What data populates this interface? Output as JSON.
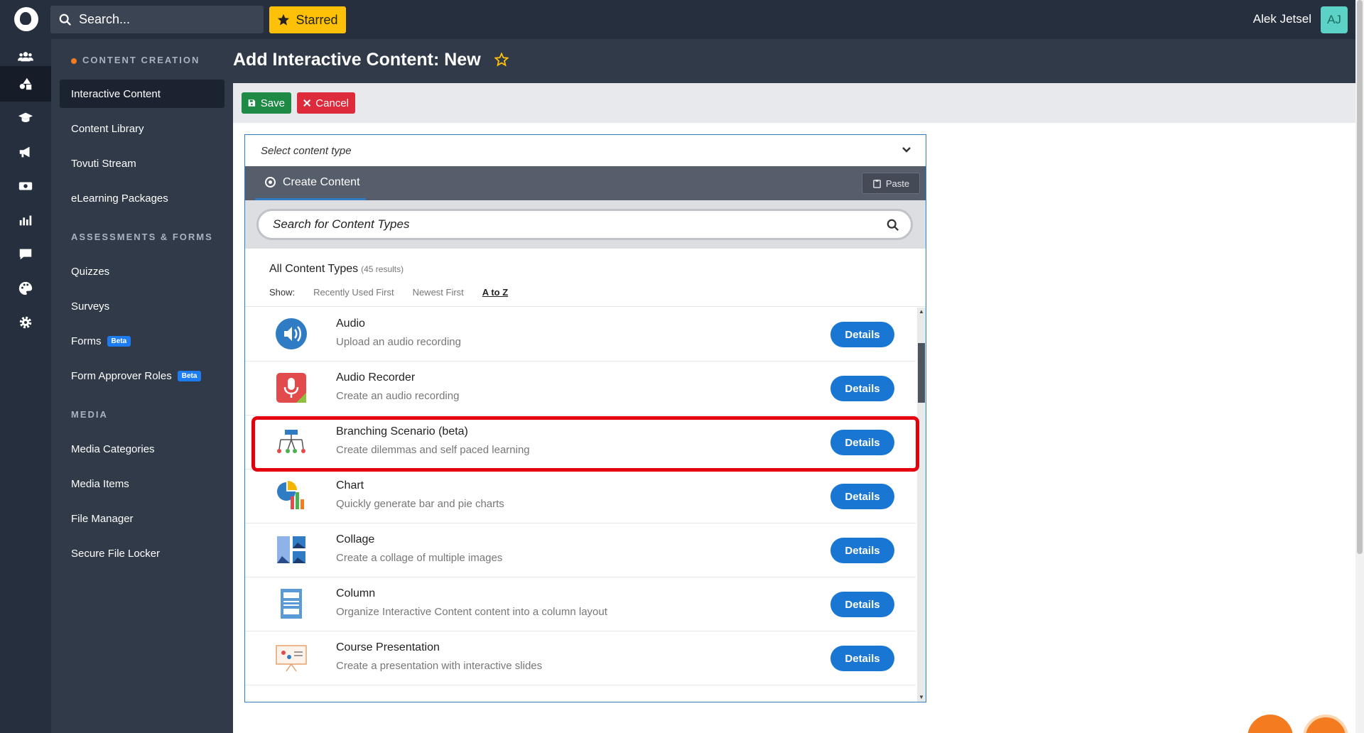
{
  "topbar": {
    "search_placeholder": "Search...",
    "starred_label": "Starred",
    "user_name": "Alek Jetsel",
    "user_initials": "AJ"
  },
  "rail": {
    "items": [
      "users-icon",
      "content-icon",
      "graduation-cap-icon",
      "megaphone-icon",
      "media-icon",
      "analytics-icon",
      "chat-icon",
      "palette-icon",
      "gear-icon"
    ],
    "active_index": 1
  },
  "sidenav": {
    "sections": [
      {
        "title": "CONTENT CREATION",
        "items": [
          "Interactive Content",
          "Content Library",
          "Tovuti Stream",
          "eLearning Packages"
        ]
      },
      {
        "title": "ASSESSMENTS & FORMS",
        "items": [
          "Quizzes",
          "Surveys",
          "Forms",
          "Form Approver Roles"
        ]
      },
      {
        "title": "MEDIA",
        "items": [
          "Media Categories",
          "Media Items",
          "File Manager",
          "Secure File Locker"
        ]
      }
    ],
    "beta_label": "Beta",
    "active_item": "Interactive Content"
  },
  "page": {
    "title": "Add Interactive Content: New",
    "save_label": "Save",
    "cancel_label": "Cancel"
  },
  "hub": {
    "select_placeholder": "Select content type",
    "tab_label": "Create Content",
    "paste_label": "Paste",
    "search_placeholder": "Search for Content Types",
    "list_title": "All Content Types",
    "result_count": "(45 results)",
    "show_label": "Show:",
    "sort_options": [
      "Recently Used First",
      "Newest First",
      "A to Z"
    ],
    "selected_sort": "A to Z",
    "details_label": "Details",
    "items": [
      {
        "name": "Audio",
        "desc": "Upload an audio recording",
        "icon": "audio-icon"
      },
      {
        "name": "Audio Recorder",
        "desc": "Create an audio recording",
        "icon": "microphone-icon"
      },
      {
        "name": "Branching Scenario (beta)",
        "desc": "Create dilemmas and self paced learning",
        "icon": "branching-icon"
      },
      {
        "name": "Chart",
        "desc": "Quickly generate bar and pie charts",
        "icon": "chart-icon"
      },
      {
        "name": "Collage",
        "desc": "Create a collage of multiple images",
        "icon": "collage-icon"
      },
      {
        "name": "Column",
        "desc": "Organize Interactive Content content into a column layout",
        "icon": "column-icon"
      },
      {
        "name": "Course Presentation",
        "desc": "Create a presentation with interactive slides",
        "icon": "presentation-icon"
      }
    ]
  },
  "colors": {
    "topbar": "#262f3d",
    "accent": "#1976d2",
    "starred": "#ffc107",
    "save": "#1e8a46",
    "cancel": "#dd2b3b",
    "highlight": "#e5000f"
  }
}
